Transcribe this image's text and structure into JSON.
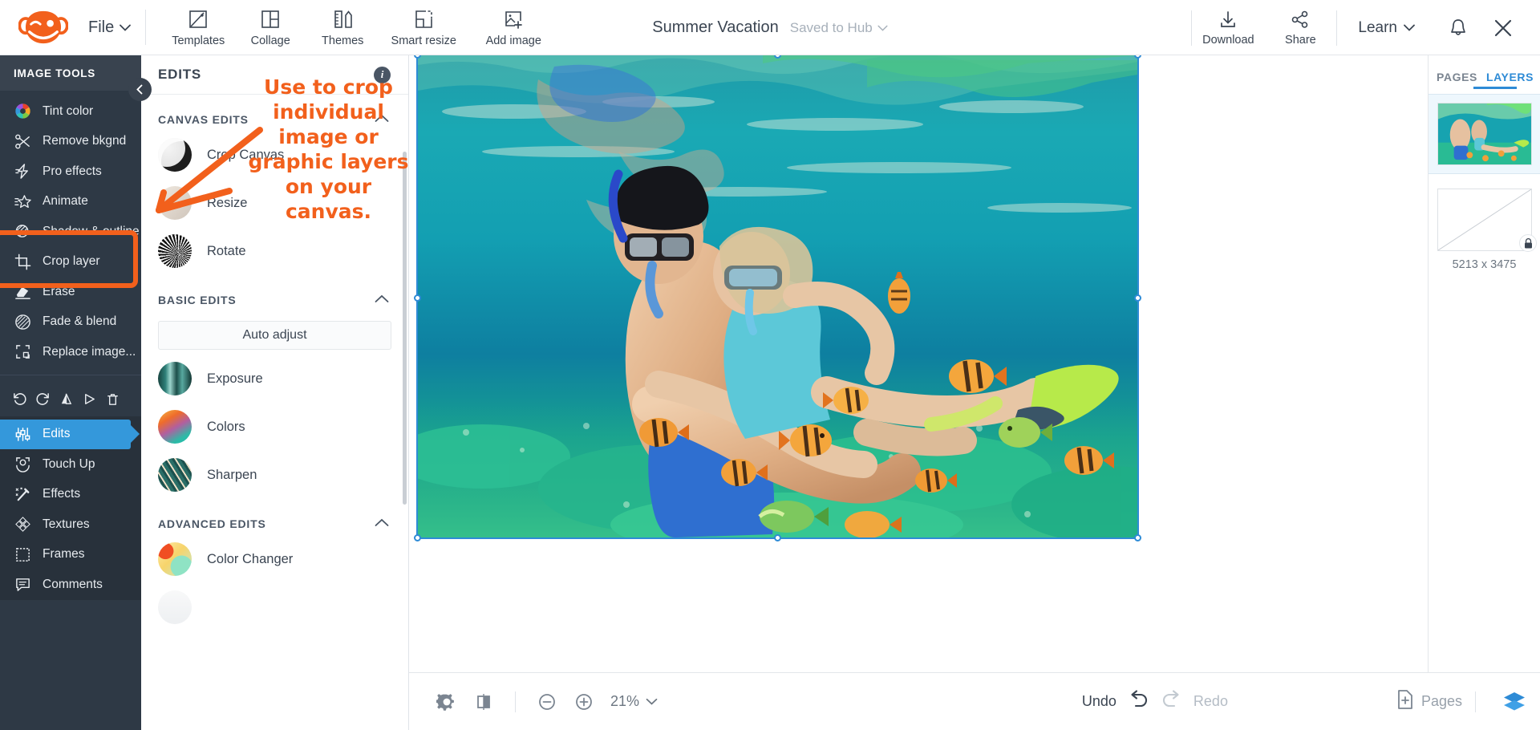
{
  "app": {
    "name": "PicMonkey Editor",
    "accent_orange": "#f2601c",
    "accent_blue": "#2e8bd6",
    "rail_bg": "#2e3945"
  },
  "topbar": {
    "logo_name": "picmonkey-monkey-logo",
    "file_menu": "File",
    "tools": [
      {
        "label": "Templates",
        "icon": "templates-icon"
      },
      {
        "label": "Collage",
        "icon": "collage-icon"
      },
      {
        "label": "Themes",
        "icon": "themes-icon"
      },
      {
        "label": "Smart resize",
        "icon": "smart-resize-icon"
      },
      {
        "label": "Add image",
        "icon": "add-image-icon"
      }
    ],
    "doc_title": "Summer Vacation",
    "save_status": "Saved to Hub",
    "download": "Download",
    "share": "Share",
    "learn": "Learn",
    "bell_icon": "bell-icon",
    "close_icon": "close-icon"
  },
  "rail": {
    "heading": "IMAGE TOOLS",
    "items": [
      {
        "label": "Tint color",
        "icon": "color-wheel-icon"
      },
      {
        "label": "Remove bkgnd",
        "icon": "scissors-icon"
      },
      {
        "label": "Pro effects",
        "icon": "lightning-icon"
      },
      {
        "label": "Animate",
        "icon": "animate-star-icon"
      },
      {
        "label": "Shadow & outline",
        "icon": "shadow-outline-icon"
      },
      {
        "label": "Crop layer",
        "icon": "crop-icon"
      },
      {
        "label": "Erase",
        "icon": "eraser-icon"
      },
      {
        "label": "Fade & blend",
        "icon": "fade-blend-icon"
      },
      {
        "label": "Replace image...",
        "icon": "replace-image-icon"
      }
    ],
    "actions": [
      {
        "name": "undo-icon"
      },
      {
        "name": "redo-icon"
      },
      {
        "name": "flip-horizontal-icon"
      },
      {
        "name": "flip-vertical-icon"
      },
      {
        "name": "delete-icon"
      }
    ],
    "nav": [
      {
        "label": "Edits",
        "icon": "sliders-icon",
        "active": true
      },
      {
        "label": "Touch Up",
        "icon": "face-icon",
        "active": false
      },
      {
        "label": "Effects",
        "icon": "wand-icon",
        "active": false
      },
      {
        "label": "Textures",
        "icon": "textures-icon",
        "active": false
      },
      {
        "label": "Frames",
        "icon": "frame-icon",
        "active": false
      },
      {
        "label": "Comments",
        "icon": "comment-icon",
        "active": false
      }
    ]
  },
  "edits_panel": {
    "title": "EDITS",
    "info_icon": "info-icon",
    "sections": [
      {
        "title": "CANVAS EDITS",
        "items": [
          {
            "label": "Crop Canvas",
            "thumb": "crop-canvas-thumb"
          },
          {
            "label": "Resize",
            "thumb": "resize-thumb"
          },
          {
            "label": "Rotate",
            "thumb": "rotate-thumb"
          }
        ]
      },
      {
        "title": "BASIC EDITS",
        "button": "Auto adjust",
        "items": [
          {
            "label": "Exposure",
            "thumb": "exposure-thumb"
          },
          {
            "label": "Colors",
            "thumb": "colors-thumb"
          },
          {
            "label": "Sharpen",
            "thumb": "sharpen-thumb"
          }
        ]
      },
      {
        "title": "ADVANCED EDITS",
        "items": [
          {
            "label": "Color Changer",
            "thumb": "color-changer-thumb"
          }
        ]
      }
    ]
  },
  "annotation": {
    "text": "Use to crop individual image or graphic layers on your canvas.",
    "color": "#f2601c"
  },
  "right_panel": {
    "tabs": [
      {
        "label": "PAGES",
        "active": false
      },
      {
        "label": "LAYERS",
        "active": true
      }
    ],
    "close_icon": "close-panel-icon",
    "layers": [
      {
        "name": "snorkeling-photo-layer",
        "selected": true
      },
      {
        "name": "empty-background-layer",
        "selected": false,
        "locked": true,
        "lock_icon": "lock-icon"
      }
    ],
    "canvas_dimensions": "5213 x 3475"
  },
  "bottombar": {
    "settings_icon": "gear-icon",
    "compare_icon": "before-after-icon",
    "zoom_out_icon": "zoom-out-icon",
    "zoom_in_icon": "zoom-in-icon",
    "zoom_level": "21%",
    "zoom_chevron": "chevron-down-icon",
    "undo": "Undo",
    "redo": "Redo",
    "add_page": "Pages",
    "add_page_icon": "add-page-icon",
    "layers_icon": "layers-stack-icon"
  }
}
